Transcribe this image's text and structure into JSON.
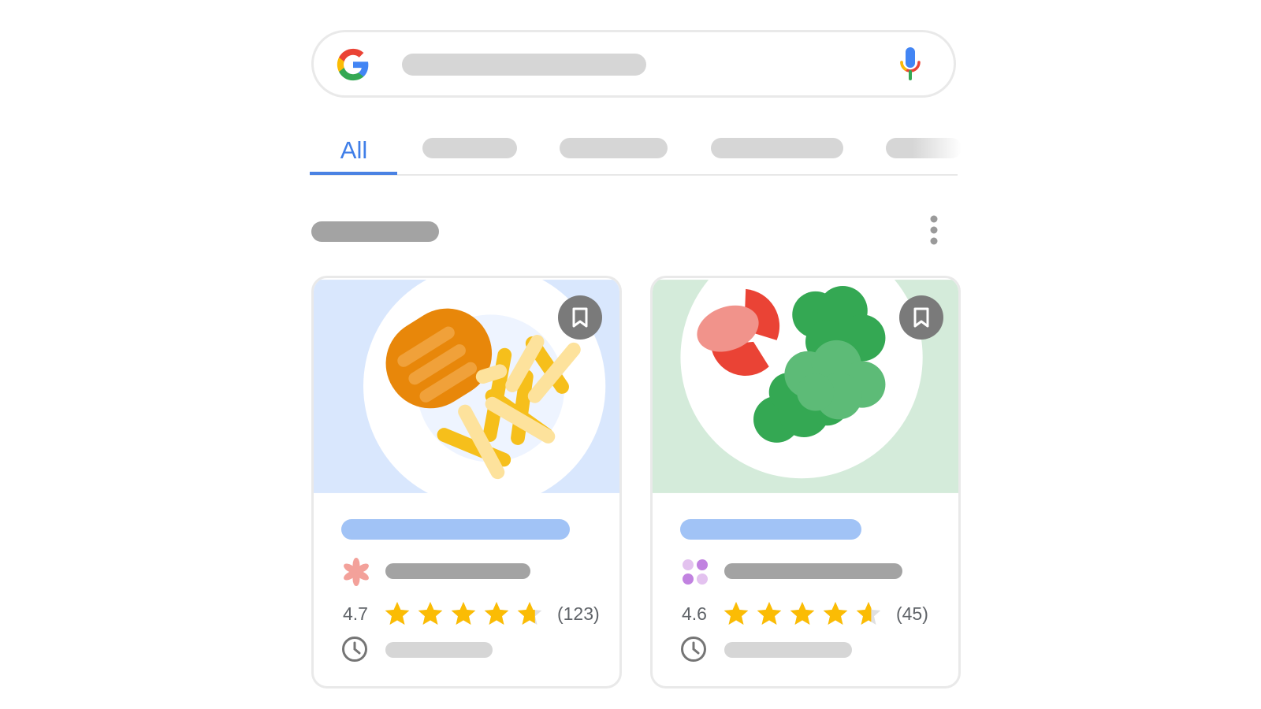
{
  "search": {
    "logo_icon": "google-g-icon",
    "mic_icon": "microphone-icon"
  },
  "tabs": {
    "active_label": "All"
  },
  "section": {
    "more_icon": "more-vert-icon"
  },
  "cards": [
    {
      "image_icon": "chicken-fries-plate-icon",
      "source_icon": "flower-logo-icon",
      "rating": "4.7",
      "rating_value": 4.7,
      "review_count": "(123)",
      "time_icon": "clock-icon",
      "bookmark_icon": "bookmark-icon"
    },
    {
      "image_icon": "salad-plate-icon",
      "source_icon": "dots-logo-icon",
      "rating": "4.6",
      "rating_value": 4.6,
      "review_count": "(45)",
      "time_icon": "clock-icon",
      "bookmark_icon": "bookmark-icon"
    }
  ],
  "colors": {
    "accent": "#3f7ee8",
    "star": "#fbbc04",
    "star_empty": "#e0e0e0",
    "placeholder_dark": "#a3a3a3",
    "placeholder_light": "#d6d6d6",
    "title_placeholder": "#a1c3f6",
    "card1_bg": "#d9e7fd",
    "card2_bg": "#d4ebda"
  }
}
